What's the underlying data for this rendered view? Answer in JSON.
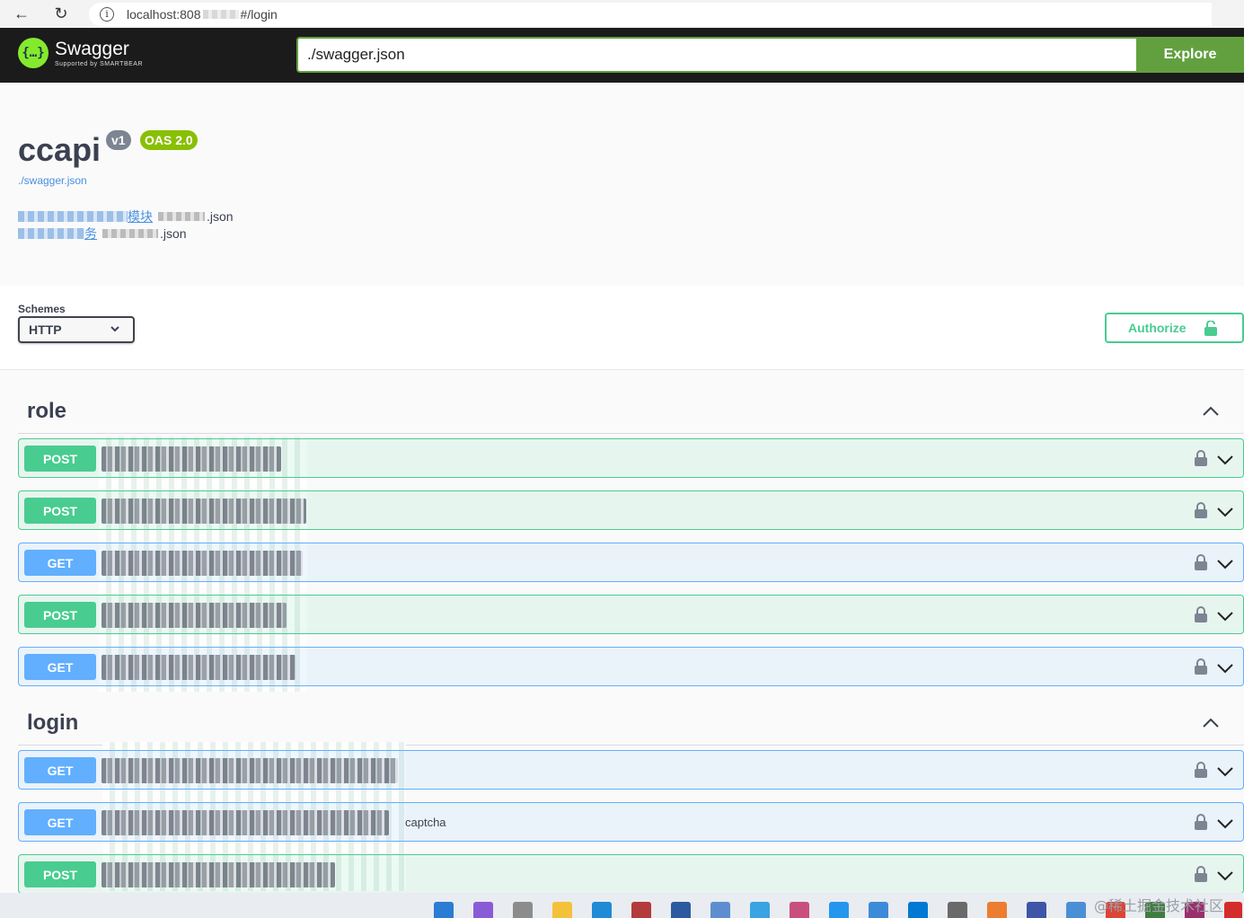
{
  "browser": {
    "url_prefix": "localhost:808",
    "url_suffix": "#/login"
  },
  "topbar": {
    "logo_title": "Swagger",
    "logo_sub": "Supported by SMARTBEAR",
    "spec_url": "./swagger.json",
    "explore_label": "Explore"
  },
  "info": {
    "title": "ccapi",
    "version": "v1",
    "oas": "OAS 2.0",
    "spec_link": "./swagger.json",
    "specs": [
      {
        "link_tail": "模块",
        "file_tail": ".json"
      },
      {
        "link_tail": "务",
        "file_tail": ".json"
      }
    ]
  },
  "schemes": {
    "label": "Schemes",
    "selected": "HTTP",
    "authorize_label": "Authorize"
  },
  "tags": [
    {
      "name": "role",
      "operations": [
        {
          "method": "POST",
          "summary": ""
        },
        {
          "method": "POST",
          "summary": ""
        },
        {
          "method": "GET",
          "summary": ""
        },
        {
          "method": "POST",
          "summary": ""
        },
        {
          "method": "GET",
          "summary": ""
        }
      ]
    },
    {
      "name": "login",
      "operations": [
        {
          "method": "GET",
          "summary": ""
        },
        {
          "method": "GET",
          "summary": "captcha"
        },
        {
          "method": "POST",
          "summary": ""
        }
      ]
    }
  ],
  "watermark": "@稀土掘金技术社区",
  "colors": {
    "post": "#49cc90",
    "get": "#61affe",
    "topbar": "#1b1b1b",
    "explore": "#62a03f"
  }
}
